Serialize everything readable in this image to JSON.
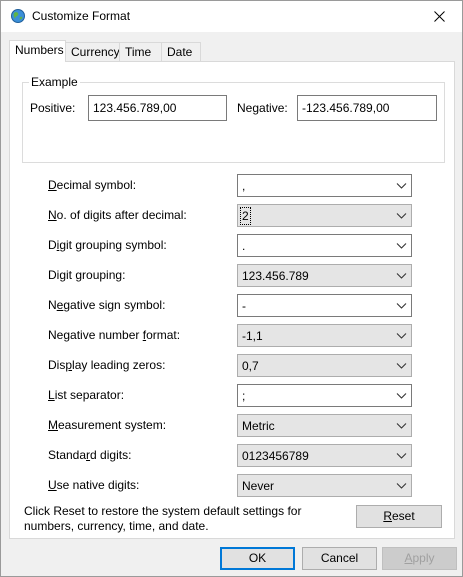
{
  "window": {
    "title": "Customize Format"
  },
  "tabs": [
    {
      "label": "Numbers"
    },
    {
      "label": "Currency"
    },
    {
      "label": "Time"
    },
    {
      "label": "Date"
    }
  ],
  "example": {
    "group_label": "Example",
    "positive_label": "Positive:",
    "positive_value": "123.456.789,00",
    "negative_label": "Negative:",
    "negative_value": "-123.456.789,00"
  },
  "settings": [
    {
      "accel": "D",
      "rest": "ecimal symbol:",
      "value": ","
    },
    {
      "accel": "N",
      "rest": "o. of digits after decimal:",
      "value": "2"
    },
    {
      "pre": "D",
      "accel": "i",
      "rest": "git grouping symbol:",
      "value": "."
    },
    {
      "pre": "Digit ",
      "accel": "g",
      "rest": "rouping:",
      "value": "123.456.789"
    },
    {
      "pre": "N",
      "accel": "e",
      "rest": "gative sign symbol:",
      "value": "-"
    },
    {
      "pre": "Negative number ",
      "accel": "f",
      "rest": "ormat:",
      "value": "-1,1"
    },
    {
      "pre": "Dis",
      "accel": "p",
      "rest": "lay leading zeros:",
      "value": "0,7"
    },
    {
      "accel": "L",
      "rest": "ist separator:",
      "value": ";"
    },
    {
      "accel": "M",
      "rest": "easurement system:",
      "value": "Metric"
    },
    {
      "pre": "Standa",
      "accel": "r",
      "rest": "d digits:",
      "value": "0123456789"
    },
    {
      "accel": "U",
      "rest": "se native digits:",
      "value": "Never"
    }
  ],
  "reset_text": "Click Reset to restore the system default settings for numbers, currency, time, and date.",
  "buttons": {
    "reset": {
      "accel": "R",
      "rest": "eset"
    },
    "ok": "OK",
    "cancel": "Cancel",
    "apply": {
      "accel": "A",
      "rest": "pply"
    }
  },
  "icons": {
    "app": "globe-icon",
    "close": "close-icon",
    "dropdown": "chevron-down-icon"
  }
}
